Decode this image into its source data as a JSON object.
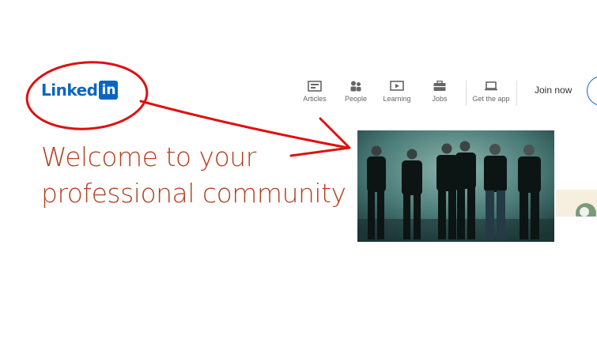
{
  "brand": {
    "word": "Linked",
    "box": "in"
  },
  "nav": {
    "items": [
      {
        "label": "Articles",
        "icon": "articles-icon"
      },
      {
        "label": "People",
        "icon": "people-icon"
      },
      {
        "label": "Learning",
        "icon": "learning-icon"
      },
      {
        "label": "Jobs",
        "icon": "jobs-icon"
      },
      {
        "label": "Get the app",
        "icon": "laptop-icon"
      }
    ],
    "join_label": "Join now"
  },
  "hero": {
    "headline_line1": "Welcome to your",
    "headline_line2": "professional community"
  },
  "colors": {
    "brand_blue": "#0a66c2",
    "headline": "#b24020",
    "annotation_red": "#e01010"
  }
}
